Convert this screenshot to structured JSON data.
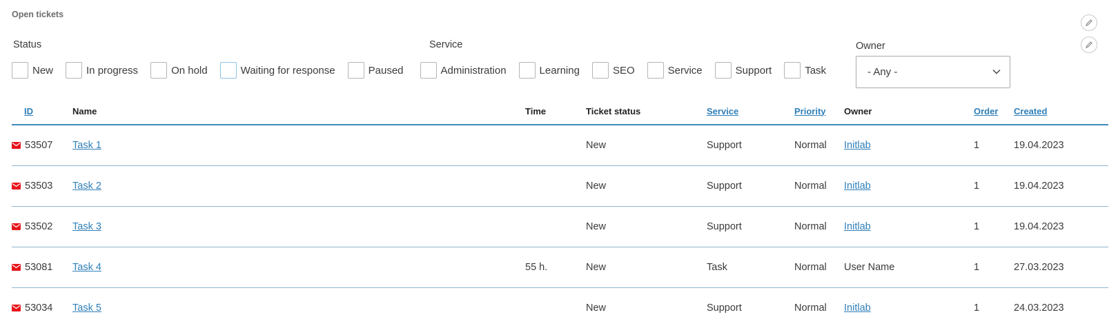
{
  "page": {
    "title": "Open tickets"
  },
  "filters": {
    "status_label": "Status",
    "service_label": "Service",
    "owner_label": "Owner",
    "owner_value": "- Any -",
    "checkboxes": [
      {
        "label": "New"
      },
      {
        "label": "In progress"
      },
      {
        "label": "On hold"
      },
      {
        "label": "Waiting for response"
      },
      {
        "label": "Paused"
      },
      {
        "label": "Administration"
      },
      {
        "label": "Learning"
      },
      {
        "label": "SEO"
      },
      {
        "label": "Service"
      },
      {
        "label": "Support"
      },
      {
        "label": "Task"
      }
    ]
  },
  "table": {
    "headers": {
      "id": "ID",
      "name": "Name",
      "time": "Time",
      "ticket_status": "Ticket status",
      "service": "Service",
      "priority": "Priority",
      "owner": "Owner",
      "order": "Order",
      "created": "Created"
    },
    "rows": [
      {
        "id": "53507",
        "name": "Task 1",
        "time": "",
        "status": "New",
        "service": "Support",
        "priority": "Normal",
        "owner": "Initlab",
        "owner_link": true,
        "order": "1",
        "created": "19.04.2023"
      },
      {
        "id": "53503",
        "name": "Task 2",
        "time": "",
        "status": "New",
        "service": "Support",
        "priority": "Normal",
        "owner": "Initlab",
        "owner_link": true,
        "order": "1",
        "created": "19.04.2023"
      },
      {
        "id": "53502",
        "name": "Task 3",
        "time": "",
        "status": "New",
        "service": "Support",
        "priority": "Normal",
        "owner": "Initlab",
        "owner_link": true,
        "order": "1",
        "created": "19.04.2023"
      },
      {
        "id": "53081",
        "name": "Task 4",
        "time": "55 h.",
        "status": "New",
        "service": "Task",
        "priority": "Normal",
        "owner": "User Name",
        "owner_link": false,
        "order": "1",
        "created": "27.03.2023"
      },
      {
        "id": "53034",
        "name": "Task 5",
        "time": "",
        "status": "New",
        "service": "Support",
        "priority": "Normal",
        "owner": "Initlab",
        "owner_link": true,
        "order": "1",
        "created": "24.03.2023"
      }
    ]
  },
  "icons": {
    "edit": "pencil-icon",
    "mail": "envelope-icon",
    "dropdown": "chevron-down-icon"
  },
  "colors": {
    "accent": "#2f7fb8",
    "mail_icon": "#e8151b",
    "header_rule": "#3b8ab8",
    "row_rule": "#8fb6cf"
  }
}
